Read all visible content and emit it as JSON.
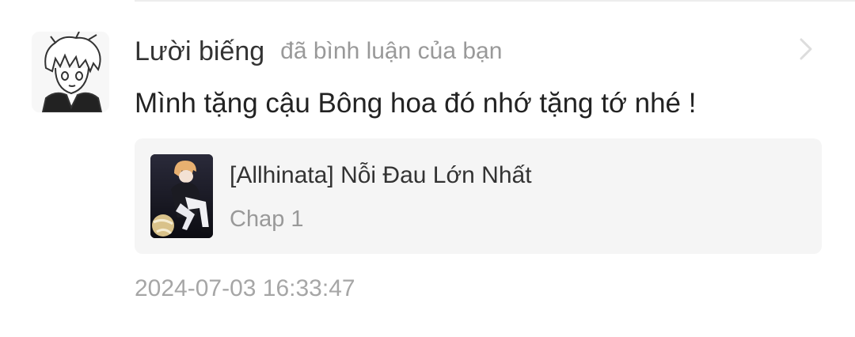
{
  "notification": {
    "username": "Lười biếng",
    "action_text": "đã bình luận của bạn",
    "comment": "Mình tặng cậu Bông hoa đó nhớ tặng tớ nhé !",
    "timestamp": "2024-07-03 16:33:47",
    "chevron_icon": "chevron-right-icon",
    "avatar_icon": "manga-avatar"
  },
  "story": {
    "title": "[Allhinata] Nỗi Đau Lớn Nhất",
    "chapter": "Chap 1",
    "cover_icon": "story-cover-image"
  },
  "colors": {
    "username": "#333333",
    "secondary_text": "#999999",
    "card_background": "#f5f5f5",
    "divider": "#ededed"
  }
}
